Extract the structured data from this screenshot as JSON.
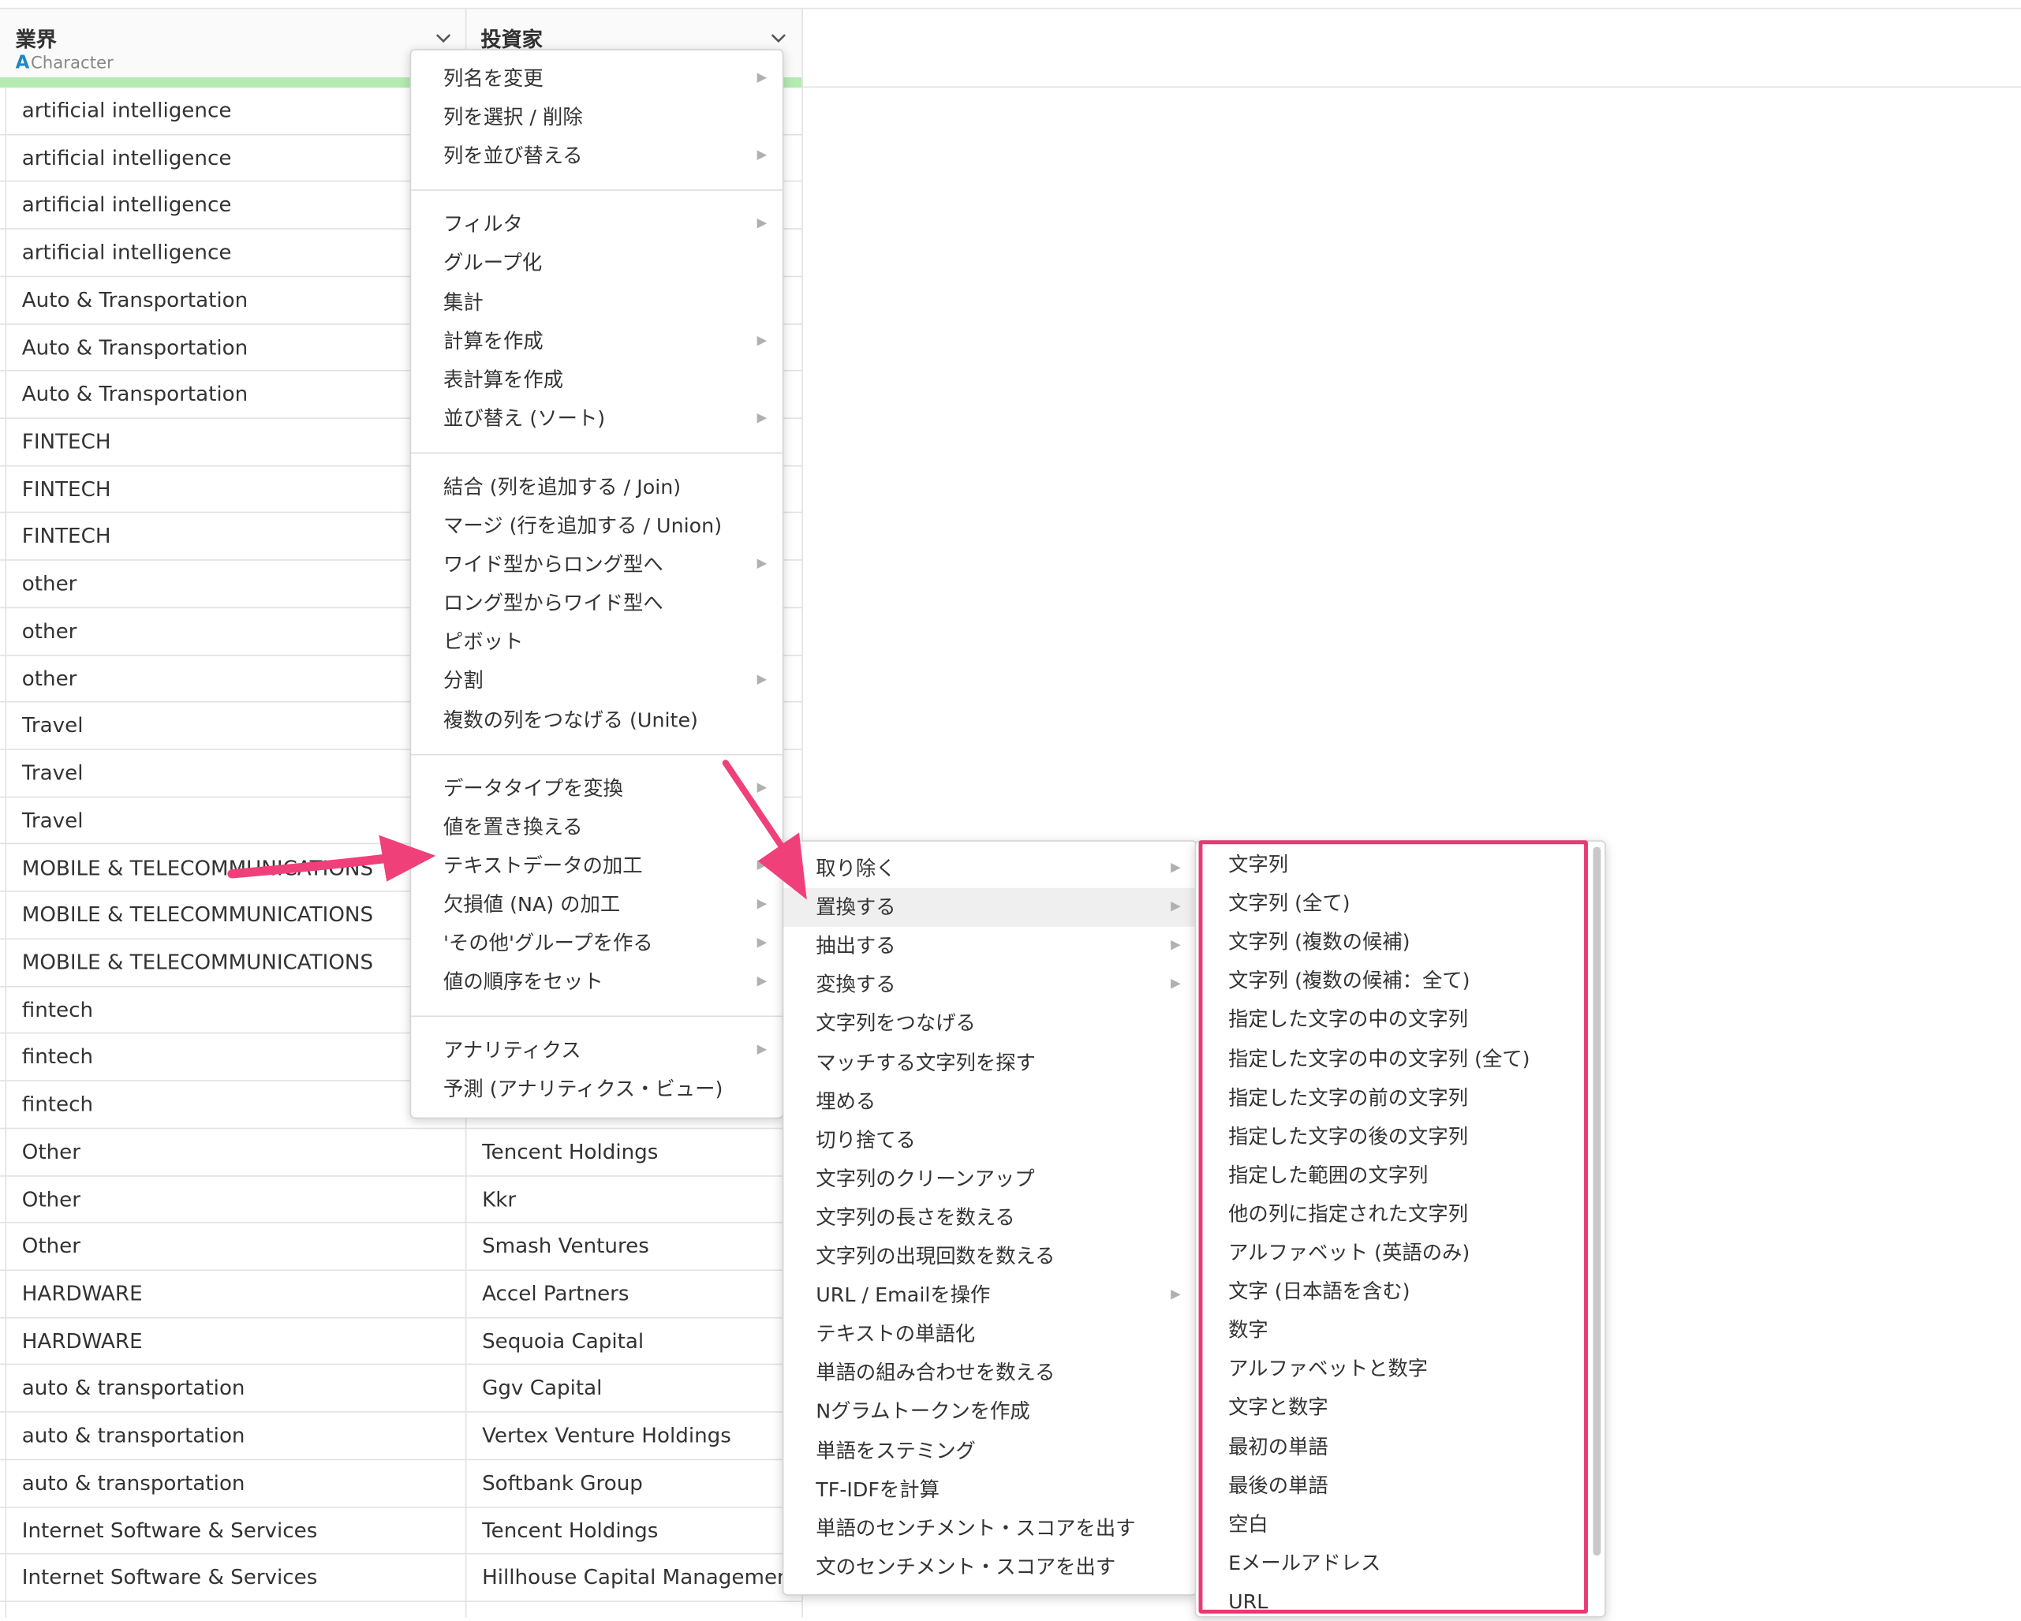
{
  "table": {
    "col1": {
      "title": "業界",
      "type_icon": "A",
      "type_label": "Character"
    },
    "col2": {
      "title": "投資家"
    },
    "rows": [
      [
        "artificial intelligence",
        ""
      ],
      [
        "artificial intelligence",
        ""
      ],
      [
        "artificial intelligence",
        ""
      ],
      [
        "artificial intelligence",
        ""
      ],
      [
        "Auto & Transportation",
        ""
      ],
      [
        "Auto & Transportation",
        ""
      ],
      [
        "Auto & Transportation",
        ""
      ],
      [
        "FINTECH",
        ""
      ],
      [
        "FINTECH",
        ""
      ],
      [
        "FINTECH",
        ""
      ],
      [
        "other",
        ""
      ],
      [
        "other",
        ""
      ],
      [
        "other",
        ""
      ],
      [
        "Travel",
        ""
      ],
      [
        "Travel",
        ""
      ],
      [
        "Travel",
        ""
      ],
      [
        "MOBILE & TELECOMMUNICATIONS",
        ""
      ],
      [
        "MOBILE & TELECOMMUNICATIONS",
        ""
      ],
      [
        "MOBILE & TELECOMMUNICATIONS",
        ""
      ],
      [
        "fintech",
        ""
      ],
      [
        "fintech",
        ""
      ],
      [
        "fintech",
        ""
      ],
      [
        "Other",
        "Tencent Holdings"
      ],
      [
        "Other",
        "Kkr"
      ],
      [
        "Other",
        "Smash Ventures"
      ],
      [
        "HARDWARE",
        "Accel Partners"
      ],
      [
        "HARDWARE",
        "Sequoia   Capital"
      ],
      [
        "auto & transportation",
        "Ggv Capital"
      ],
      [
        "auto & transportation",
        "Vertex Venture   Holdings"
      ],
      [
        "auto & transportation",
        "Softbank Group"
      ],
      [
        "Internet Software & Services",
        "Tencent Holdings"
      ],
      [
        "Internet Software & Services",
        "Hillhouse Capital Management"
      ]
    ]
  },
  "column_menu": {
    "groups": [
      [
        {
          "label": "列名を変更",
          "submenu": true
        },
        {
          "label": "列を選択 / 削除",
          "submenu": false
        },
        {
          "label": "列を並び替える",
          "submenu": true
        }
      ],
      [
        {
          "label": "フィルタ",
          "submenu": true
        },
        {
          "label": "グループ化",
          "submenu": false
        },
        {
          "label": "集計",
          "submenu": false
        },
        {
          "label": "計算を作成",
          "submenu": true
        },
        {
          "label": "表計算を作成",
          "submenu": false
        },
        {
          "label": "並び替え (ソート)",
          "submenu": true
        }
      ],
      [
        {
          "label": "結合 (列を追加する / Join)",
          "submenu": false
        },
        {
          "label": "マージ (行を追加する / Union)",
          "submenu": false
        },
        {
          "label": "ワイド型からロング型へ",
          "submenu": true
        },
        {
          "label": "ロング型からワイド型へ",
          "submenu": false
        },
        {
          "label": "ピボット",
          "submenu": false
        },
        {
          "label": "分割",
          "submenu": true
        },
        {
          "label": "複数の列をつなげる (Unite)",
          "submenu": false
        }
      ],
      [
        {
          "label": "データタイプを変換",
          "submenu": true
        },
        {
          "label": "値を置き換える",
          "submenu": false
        },
        {
          "label": "テキストデータの加工",
          "submenu": true
        },
        {
          "label": "欠損値 (NA) の加工",
          "submenu": true
        },
        {
          "label": "'その他'グループを作る",
          "submenu": true
        },
        {
          "label": "値の順序をセット",
          "submenu": true
        }
      ],
      [
        {
          "label": "アナリティクス",
          "submenu": true
        },
        {
          "label": "予測 (アナリティクス・ビュー)",
          "submenu": false
        }
      ]
    ]
  },
  "text_menu": {
    "items": [
      {
        "label": "取り除く",
        "submenu": true
      },
      {
        "label": "置換する",
        "submenu": true,
        "active": true
      },
      {
        "label": "抽出する",
        "submenu": true
      },
      {
        "label": "変換する",
        "submenu": true
      },
      {
        "label": "文字列をつなげる",
        "submenu": false
      },
      {
        "label": "マッチする文字列を探す",
        "submenu": false
      },
      {
        "label": "埋める",
        "submenu": false
      },
      {
        "label": "切り捨てる",
        "submenu": false
      },
      {
        "label": "文字列のクリーンアップ",
        "submenu": false
      },
      {
        "label": "文字列の長さを数える",
        "submenu": false
      },
      {
        "label": "文字列の出現回数を数える",
        "submenu": false
      },
      {
        "label": "URL / Emailを操作",
        "submenu": true
      },
      {
        "label": "テキストの単語化",
        "submenu": false
      },
      {
        "label": "単語の組み合わせを数える",
        "submenu": false
      },
      {
        "label": "Nグラムトークンを作成",
        "submenu": false
      },
      {
        "label": "単語をステミング",
        "submenu": false
      },
      {
        "label": "TF-IDFを計算",
        "submenu": false
      },
      {
        "label": "単語のセンチメント・スコアを出す",
        "submenu": false
      },
      {
        "label": "文のセンチメント・スコアを出す",
        "submenu": false
      }
    ]
  },
  "replace_menu": {
    "items": [
      "文字列",
      "文字列 (全て)",
      "文字列 (複数の候補)",
      "文字列 (複数の候補：全て)",
      "指定した文字の中の文字列",
      "指定した文字の中の文字列 (全て)",
      "指定した文字の前の文字列",
      "指定した文字の後の文字列",
      "指定した範囲の文字列",
      "他の列に指定された文字列",
      "アルファベット (英語のみ)",
      "文字 (日本語を含む)",
      "数字",
      "アルファベットと数字",
      "文字と数字",
      "最初の単語",
      "最後の単語",
      "空白",
      "Eメールアドレス",
      "URL"
    ]
  },
  "colors": {
    "annotation_pink": "#f0407a",
    "highlight_border": "#e83a72",
    "header_green_bar": "#b4ecb0",
    "type_icon_blue": "#1e88c9"
  },
  "icons": {
    "submenu_arrow": "triangle-right-icon",
    "column_dropdown": "chevron-down-icon",
    "annotation_arrows": "pink-arrow-icon"
  }
}
